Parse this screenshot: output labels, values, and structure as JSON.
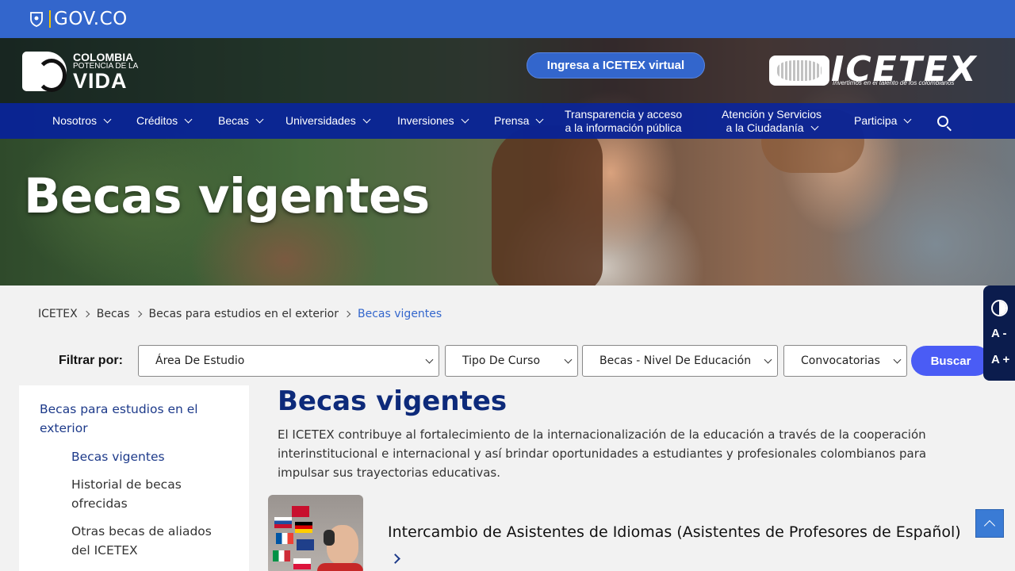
{
  "govbar": {
    "label": "GOV.CO",
    "icon": "colombia-shield-icon"
  },
  "brand": {
    "colombia_line1": "COLOMBIA",
    "colombia_line2": "POTENCIA DE LA",
    "colombia_line3": "VIDA",
    "virtual_button": "Ingresa a ICETEX virtual",
    "icetex_word": "ICETEX",
    "icetex_slogan": "Invertimos en el talento de los colombianos"
  },
  "nav": {
    "items": [
      {
        "label": "Nosotros"
      },
      {
        "label": "Créditos"
      },
      {
        "label": "Becas"
      },
      {
        "label": "Universidades"
      },
      {
        "label": "Inversiones"
      },
      {
        "label": "Prensa"
      },
      {
        "label_line1": "Transparencia y acceso",
        "label_line2": "a la información pública"
      },
      {
        "label_line1": "Atención y Servicios",
        "label_line2": "a la Ciudadanía"
      },
      {
        "label": "Participa"
      }
    ]
  },
  "hero": {
    "title": "Becas vigentes"
  },
  "breadcrumb": [
    "ICETEX",
    "Becas",
    "Becas para estudios en el exterior",
    "Becas vigentes"
  ],
  "filters": {
    "label": "Filtrar por:",
    "selects": [
      "Área De Estudio",
      "Tipo De Curso",
      "Becas - Nivel De Educación",
      "Convocatorias"
    ],
    "button": "Buscar"
  },
  "accessibility": {
    "decrease": "A -",
    "increase": "A +"
  },
  "sidebar": {
    "parent": "Becas para estudios en el exterior",
    "items": [
      "Becas vigentes",
      "Historial de becas ofrecidas",
      "Otras becas de aliados del ICETEX"
    ]
  },
  "main": {
    "title": "Becas vigentes",
    "description": "El ICETEX contribuye al fortalecimiento de la internacionalización de la educación a través de la cooperación interinstitucional e internacional y así brindar oportunidades a estudiantes y profesionales colombianos para impulsar sus trayectorias educativas.",
    "cards": [
      {
        "title": "Intercambio de Asistentes de Idiomas (Asistentes de Profesores de Español)"
      }
    ]
  },
  "colors": {
    "gov_blue": "#3366cc",
    "nav_blue": "#0824a0",
    "heading_blue": "#0d2a7a",
    "button_blue": "#4a5cf5"
  }
}
